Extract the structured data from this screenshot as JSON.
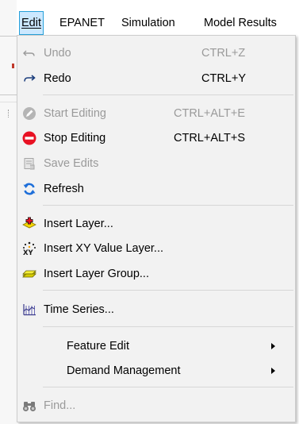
{
  "menubar": {
    "items": [
      {
        "label": "Edit",
        "active": true
      },
      {
        "label": "EPANET",
        "active": false
      },
      {
        "label": "Simulation",
        "active": false
      },
      {
        "label": "Model Results",
        "active": false
      }
    ]
  },
  "menu": {
    "undo": {
      "label": "Undo",
      "shortcut": "CTRL+Z",
      "enabled": false,
      "icon": "undo-arrow-icon"
    },
    "redo": {
      "label": "Redo",
      "shortcut": "CTRL+Y",
      "enabled": true,
      "icon": "redo-arrow-icon"
    },
    "start_editing": {
      "label": "Start Editing",
      "shortcut": "CTRL+ALT+E",
      "enabled": false,
      "icon": "start-editing-icon"
    },
    "stop_editing": {
      "label": "Stop Editing",
      "shortcut": "CTRL+ALT+S",
      "enabled": true,
      "icon": "stop-editing-icon"
    },
    "save_edits": {
      "label": "Save Edits",
      "enabled": false,
      "icon": "save-edits-icon"
    },
    "refresh": {
      "label": "Refresh",
      "enabled": true,
      "icon": "refresh-icon"
    },
    "insert_layer": {
      "label": "Insert Layer...",
      "enabled": true,
      "icon": "insert-layer-icon"
    },
    "insert_xy_layer": {
      "label": "Insert XY Value Layer...",
      "enabled": true,
      "icon": "xy-layer-icon"
    },
    "insert_layer_group": {
      "label": "Insert Layer Group...",
      "enabled": true,
      "icon": "layer-group-icon"
    },
    "time_series": {
      "label": "Time Series...",
      "enabled": true,
      "icon": "time-series-icon"
    },
    "feature_edit": {
      "label": "Feature Edit",
      "enabled": true,
      "has_submenu": true
    },
    "demand_management": {
      "label": "Demand Management",
      "enabled": true,
      "has_submenu": true
    },
    "find": {
      "label": "Find...",
      "enabled": false,
      "icon": "binoculars-icon"
    }
  },
  "colors": {
    "menu_bg": "#f2f2f2",
    "active_bg": "#cce8ff",
    "active_border": "#26a0da",
    "disabled_text": "#9a9a9a",
    "stop_red": "#e81123",
    "refresh_blue": "#1e6fd9",
    "insert_yellow": "#f5d400",
    "group_yellow": "#e8e000"
  }
}
